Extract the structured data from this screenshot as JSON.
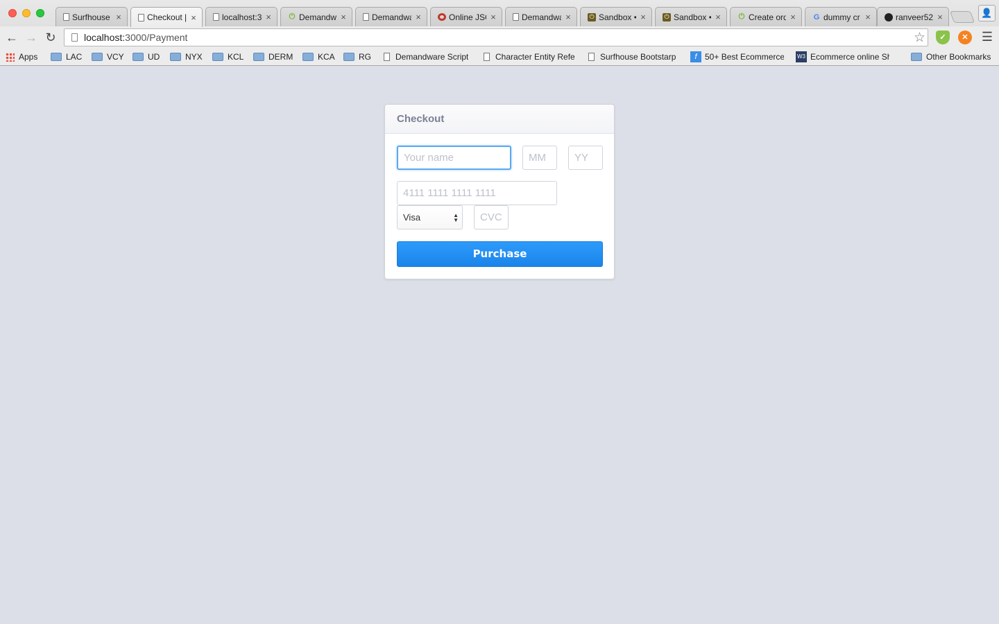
{
  "browser": {
    "tabs": [
      {
        "title": "Surfhouse",
        "icon": "page-icon",
        "active": false
      },
      {
        "title": "Checkout |",
        "icon": "page-icon",
        "active": true
      },
      {
        "title": "localhost:3",
        "icon": "page-icon",
        "active": false
      },
      {
        "title": "Demandwa",
        "icon": "power-icon",
        "active": false
      },
      {
        "title": "Demandwa",
        "icon": "page-icon",
        "active": false
      },
      {
        "title": "Online JSO",
        "icon": "ring-icon",
        "active": false
      },
      {
        "title": "Demandwa",
        "icon": "page-icon",
        "active": false
      },
      {
        "title": "Sandbox •",
        "icon": "sandbox-icon",
        "active": false
      },
      {
        "title": "Sandbox •",
        "icon": "sandbox-icon",
        "active": false
      },
      {
        "title": "Create ord",
        "icon": "power-icon",
        "active": false
      },
      {
        "title": "dummy cr",
        "icon": "google-icon",
        "active": false
      },
      {
        "title": "ranveer52",
        "icon": "github-icon",
        "active": false
      }
    ],
    "url": {
      "host": "localhost:",
      "path": "3000/Payment"
    },
    "bookmarks": [
      {
        "label": "Apps",
        "type": "apps"
      },
      {
        "label": "LAC",
        "type": "folder"
      },
      {
        "label": "VCY",
        "type": "folder"
      },
      {
        "label": "UD",
        "type": "folder"
      },
      {
        "label": "NYX",
        "type": "folder"
      },
      {
        "label": "KCL",
        "type": "folder"
      },
      {
        "label": "DERM",
        "type": "folder"
      },
      {
        "label": "KCA",
        "type": "folder"
      },
      {
        "label": "RG",
        "type": "folder"
      },
      {
        "label": "Demandware Script",
        "type": "page"
      },
      {
        "label": "Character Entity Refe",
        "type": "page"
      },
      {
        "label": "Surfhouse Bootstarp",
        "type": "page"
      },
      {
        "label": "50+ Best Ecommerce",
        "type": "fbi"
      },
      {
        "label": "Ecommerce online Sh",
        "type": "w3"
      },
      {
        "label": "Other Bookmarks",
        "type": "folder"
      }
    ]
  },
  "checkout": {
    "title": "Checkout",
    "name_placeholder": "Your name",
    "month_placeholder": "MM",
    "year_placeholder": "YY",
    "card_placeholder": "4111 1111 1111 1111",
    "card_type": "Visa",
    "cvc_placeholder": "CVC",
    "purchase_label": "Purchase"
  },
  "colors": {
    "page_background": "#dcdfe8",
    "button": "#1b84ea",
    "focus_border": "#5aa8f0"
  }
}
